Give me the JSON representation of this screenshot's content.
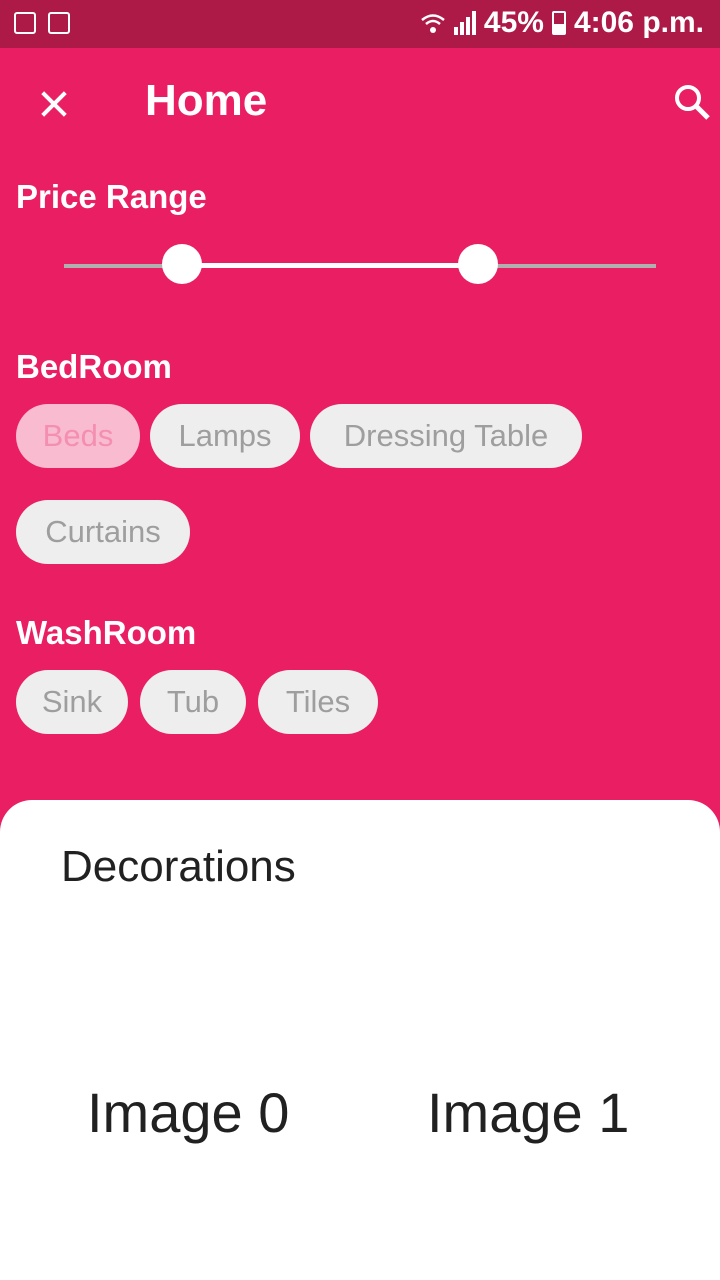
{
  "status_bar": {
    "battery": "45%",
    "time": "4:06 p.m."
  },
  "app_bar": {
    "title": "Home",
    "close_icon": "close-icon",
    "search_icon": "search-icon"
  },
  "price_range": {
    "label": "Price Range",
    "range_fraction": [
      0.2,
      0.7
    ]
  },
  "bedroom": {
    "label": "BedRoom",
    "chips": [
      "Beds",
      "Lamps",
      "Dressing Table",
      "Curtains"
    ],
    "selected": "Beds"
  },
  "washroom": {
    "label": "WashRoom",
    "chips": [
      "Sink",
      "Tub",
      "Tiles"
    ]
  },
  "sheet": {
    "title": "Decorations",
    "images": [
      "Image 0",
      "Image 1"
    ]
  },
  "colors": {
    "primary": "#E91E63",
    "status_bar": "#AD1A48",
    "chip": "#EEEEEE",
    "chip_selected": "#F8BBD0"
  }
}
